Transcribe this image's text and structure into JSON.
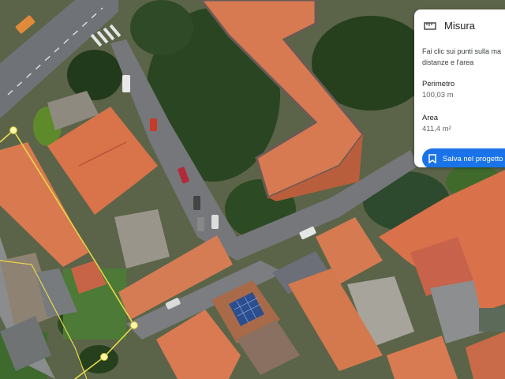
{
  "panel": {
    "title": "Misura",
    "title_icon": "ruler-icon",
    "description_line1": "Fai clic sui punti sulla ma",
    "description_line2": "distanze e l'area",
    "perimeter_label": "Perimetro",
    "perimeter_value": "100,03 m",
    "area_label": "Area",
    "area_value": "411,4 m²",
    "save_label": "Salva nel progetto",
    "save_icon": "bookmark-icon"
  },
  "colors": {
    "accent": "#1a73e8",
    "measure_line": "#e8d84a",
    "measure_vertex": "#fff7a8",
    "roof": "#d8744d",
    "road": "#6f7276",
    "vegetation": "#2f4a22"
  }
}
